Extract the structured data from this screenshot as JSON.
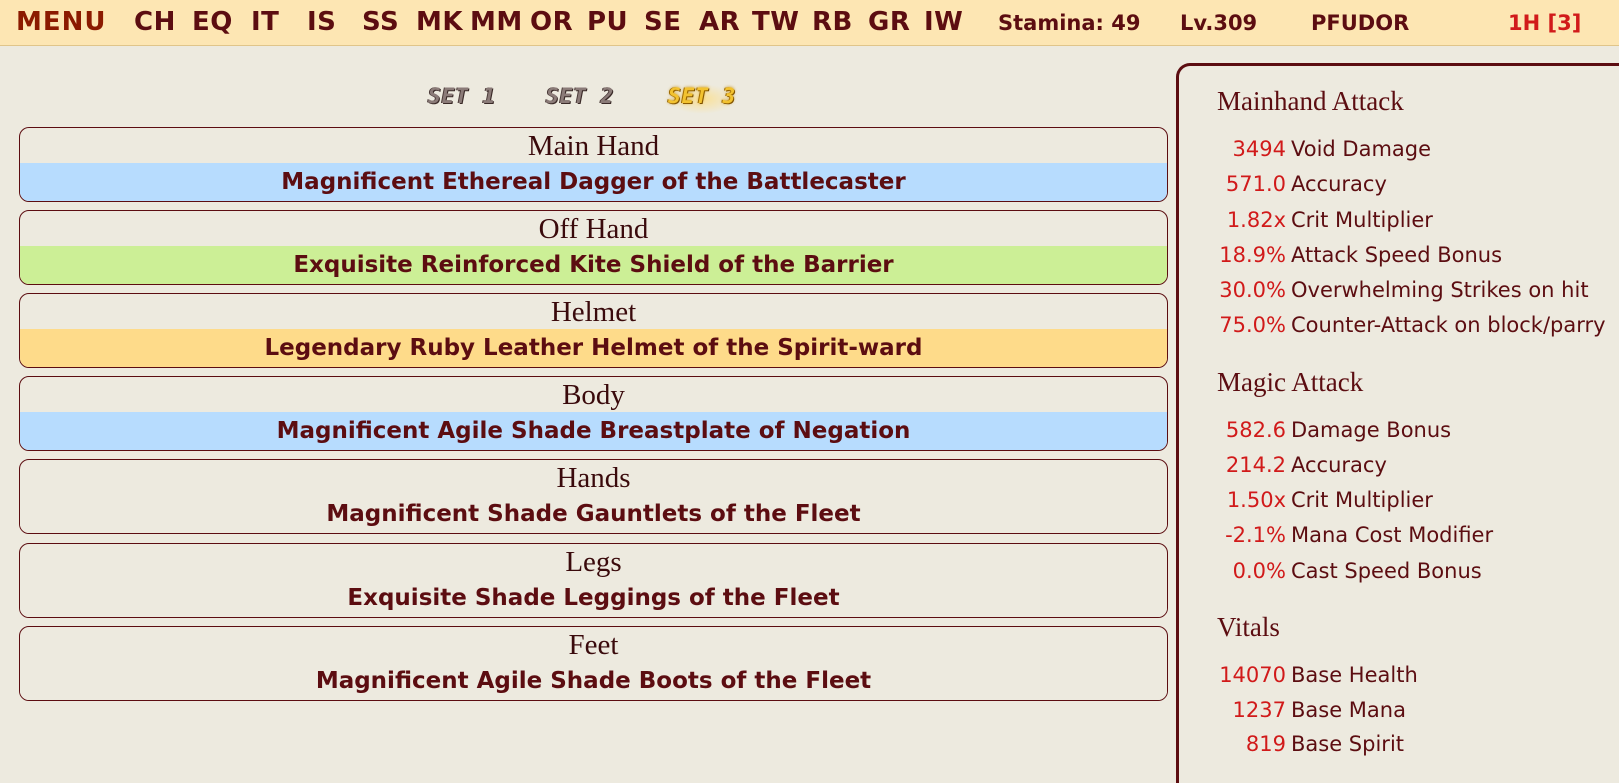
{
  "topbar": {
    "menu_label": "MENU",
    "nav": [
      "CH",
      "EQ",
      "IT",
      "IS",
      "SS",
      "MK",
      "MM",
      "OR",
      "PU",
      "SE",
      "AR",
      "TW",
      "RB",
      "GR",
      "IW"
    ],
    "stamina": "Stamina: 49",
    "level": "Lv.309",
    "player": "PFUDOR",
    "hand": "1H [3]"
  },
  "sets": {
    "labels": [
      "SET 1",
      "SET 2",
      "SET 3"
    ],
    "active": "SET 3"
  },
  "slots": [
    {
      "label": "Main Hand",
      "item": "Magnificent Ethereal Dagger of the Battlecaster",
      "color": "#B7DCFE"
    },
    {
      "label": "Off Hand",
      "item": "Exquisite Reinforced Kite Shield of the Barrier",
      "color": "#CCEF96"
    },
    {
      "label": "Helmet",
      "item": "Legendary Ruby Leather Helmet of the Spirit-ward",
      "color": "#FEDB8A"
    },
    {
      "label": "Body",
      "item": "Magnificent Agile Shade Breastplate of Negation",
      "color": "#B7DCFE"
    },
    {
      "label": "Hands",
      "item": "Magnificent Shade Gauntlets of the Fleet",
      "color": "#EDEADF"
    },
    {
      "label": "Legs",
      "item": "Exquisite Shade Leggings of the Fleet",
      "color": "#EDEADF"
    },
    {
      "label": "Feet",
      "item": "Magnificent Agile Shade Boots of the Fleet",
      "color": "#EDEADF"
    }
  ],
  "stats": {
    "mainhand": {
      "title": "Mainhand Attack",
      "rows": [
        {
          "value": "3494",
          "label": "Void Damage"
        },
        {
          "value": "571.0",
          "label": "Accuracy"
        },
        {
          "value": "1.82x",
          "label": "Crit Multiplier"
        },
        {
          "value": "18.9%",
          "label": "Attack Speed Bonus"
        },
        {
          "value": "30.0%",
          "label": "Overwhelming Strikes on hit"
        },
        {
          "value": "75.0%",
          "label": "Counter-Attack on block/parry"
        }
      ]
    },
    "magic": {
      "title": "Magic Attack",
      "rows": [
        {
          "value": "582.6",
          "label": "Damage Bonus"
        },
        {
          "value": "214.2",
          "label": "Accuracy"
        },
        {
          "value": "1.50x",
          "label": "Crit Multiplier"
        },
        {
          "value": "-2.1%",
          "label": "Mana Cost Modifier"
        },
        {
          "value": "0.0%",
          "label": "Cast Speed Bonus"
        }
      ]
    },
    "vitals": {
      "title": "Vitals",
      "rows": [
        {
          "value": "14070",
          "label": "Base Health"
        },
        {
          "value": "1237",
          "label": "Base Mana"
        },
        {
          "value": "819",
          "label": "Base Spirit"
        }
      ]
    }
  },
  "colors": {
    "accent": "#5C0D11",
    "value_red": "#D11A1A",
    "topbar_bg": "#FDE6B3",
    "page_bg": "#EDEADF"
  }
}
